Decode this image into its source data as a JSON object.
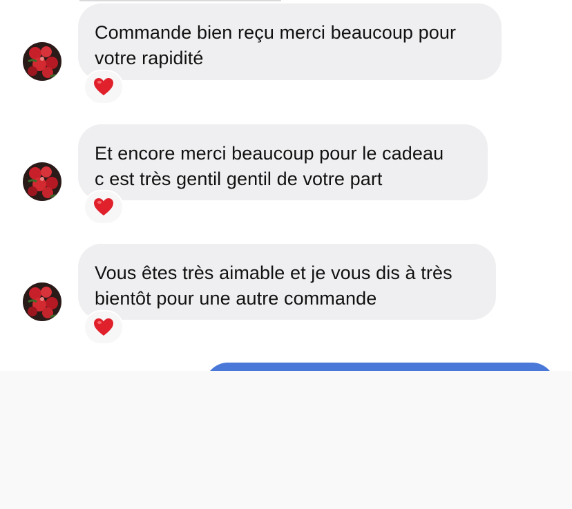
{
  "messages": [
    {
      "lines": [
        "Commande bien reçu merci beaucoup pour",
        "votre rapidité"
      ],
      "reaction": "❤️"
    },
    {
      "lines": [
        "Et encore merci beaucoup pour le cadeau",
        "c est très gentil gentil de votre part"
      ],
      "reaction": "❤️"
    },
    {
      "lines": [
        "Vous êtes très aimable et je vous dis à très",
        "bientôt pour une autre commande"
      ],
      "reaction": "❤️"
    }
  ],
  "icons": {
    "avatar": "rose-bouquet-avatar",
    "reaction": "red-heart-icon"
  },
  "colors": {
    "incoming_bubble": "#efeff1",
    "outgoing_bubble": "#4a78d8",
    "heart": "#e0202a"
  }
}
